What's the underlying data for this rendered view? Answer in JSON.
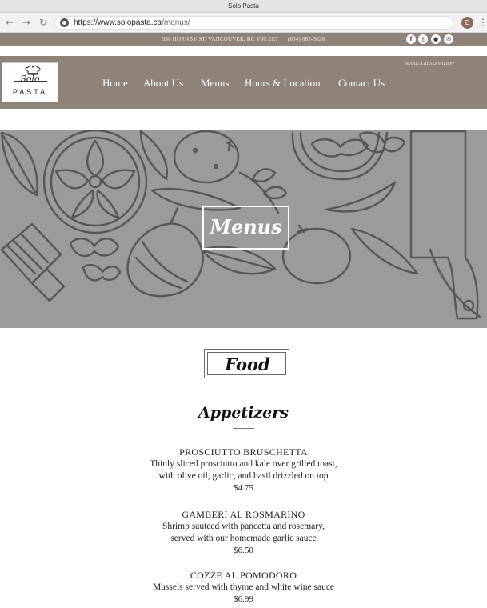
{
  "browser": {
    "window_title": "Solo Pasta",
    "url_host": "https://www.solopasta.ca",
    "url_path": "/menus/",
    "profile_initial": "E",
    "icons": [
      "back-arrow-icon",
      "forward-arrow-icon",
      "reload-icon",
      "site-info-icon",
      "more-menu-icon"
    ]
  },
  "topbar": {
    "contact": "530 HORNBY ST, VANCOUVER, BC V6C 2E7      (604) 685-3626",
    "social": [
      {
        "name": "facebook-icon",
        "glyph": "f"
      },
      {
        "name": "instagram-icon",
        "glyph": "◎"
      },
      {
        "name": "tripadvisor-icon",
        "glyph": "●"
      },
      {
        "name": "email-icon",
        "glyph": "✉"
      }
    ]
  },
  "header": {
    "logo_top": "Solo",
    "logo_bottom": "PASTA",
    "reservation_link": "MAKE A RESERVATION",
    "nav": [
      "Home",
      "About Us",
      "Menus",
      "Hours & Location",
      "Contact Us"
    ]
  },
  "hero": {
    "title": "Menus"
  },
  "menu": {
    "heading": "Food",
    "section": "Appetizers",
    "items": [
      {
        "name": "PROSCIUTTO BRUSCHETTA",
        "desc_line1": "Thinly sliced prosciutto and kale over grilled toast,",
        "desc_line2": "with olive oil, garlic, and basil drizzled on top",
        "price": "$4.75"
      },
      {
        "name": "GAMBERI AL ROSMARINO",
        "desc_line1": "Shrimp sauteed with pancetta and rosemary,",
        "desc_line2": "served with our homemade garlic sauce",
        "price": "$6.50"
      },
      {
        "name": "COZZE AL POMODORO",
        "desc_line1": "Mussels served with thyme and white wine sauce",
        "price": "$6.99"
      }
    ]
  },
  "colors": {
    "brand_taupe": "#8f8279",
    "hero_gray": "#9c9c9c",
    "text": "#222222"
  }
}
